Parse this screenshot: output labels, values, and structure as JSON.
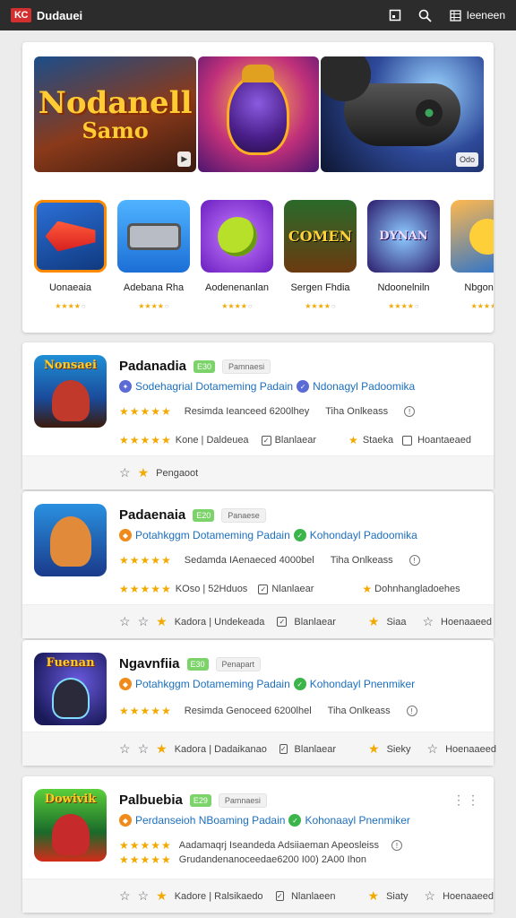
{
  "topbar": {
    "logo": "KC",
    "app_name": "Dudauei",
    "menu_label": "Ieeneen"
  },
  "featured": {
    "banners": [
      {
        "line1": "Nodanell",
        "line2": "Samo",
        "chip": ""
      },
      {
        "line1": "",
        "line2": "",
        "chip": ""
      },
      {
        "line1": "",
        "line2": "",
        "chip": "Odo"
      }
    ],
    "tiles": [
      {
        "name": "Uonaeaia",
        "glyph": ""
      },
      {
        "name": "Adebana Rha",
        "glyph": ""
      },
      {
        "name": "Aodenenanlan",
        "glyph": ""
      },
      {
        "name": "Sergen Fhdia",
        "glyph": "COMEN"
      },
      {
        "name": "Ndoonelniln",
        "glyph": "DYNAN"
      },
      {
        "name": "Nbgonieat",
        "glyph": ""
      }
    ]
  },
  "apps": [
    {
      "title": "Padanadia",
      "age": "E30",
      "category": "Pamnaesi",
      "icon_word": "Nonsaei",
      "developer": "Sodehagrial Dotameming Padain",
      "publisher": "Ndonagyl Padoomika",
      "row1_text": "Resimda Ieanceed 6200lhey",
      "row1_extra": "Tiha Onlkeass",
      "row2_text": "Kone | Daldeuea",
      "row2_check": "Blanlaear",
      "row2_right1": "Staeka",
      "row2_right2": "Hoantaeaed",
      "footer_label": "Pengaoot"
    },
    {
      "title": "Padaenaia",
      "age": "E20",
      "category": "Panaese",
      "icon_word": "",
      "developer": "Potahkggm Dotameming Padain",
      "publisher": "Kohondayl Padoomika",
      "row1_text": "Sedamda IAenaeced 4000bel",
      "row1_extra": "Tiha Onlkeass",
      "row2_text": "KOso | 52Hduos",
      "row2_check": "Nlanlaear",
      "row2_right1": "Dohnhangladoehes",
      "row2_right2": "",
      "footer_label": "Kadora | Undekeada",
      "footer_check": "Blanlaear",
      "footer_r1": "Siaa",
      "footer_r2": "Hoenaaeed"
    },
    {
      "title": "Ngavnfiia",
      "age": "E30",
      "category": "Penapart",
      "icon_word": "Fuenan",
      "developer": "Potahkggm Dotameming Padain",
      "publisher": "Kohondayl Pnenmiker",
      "row1_text": "Resimda Genoceed 6200lhel",
      "row1_extra": "Tiha Onlkeass",
      "footer_label": "Kadora | Dadaikanao",
      "footer_check": "Blanlaear",
      "footer_r1": "Sieky",
      "footer_r2": "Hoenaaeed"
    },
    {
      "title": "Palbuebia",
      "age": "E29",
      "category": "Pamnaesi",
      "icon_word": "Dowivik",
      "developer": "Perdanseioh NBoaming Padain",
      "publisher": "Kohonaayl Pnenmiker",
      "row1_text": "Aadamaqrj Iseandeda Adsiiaeman Apeosleiss",
      "row1b_text": "Grudandenanoceedae6200 I00) 2A00 Ihon",
      "footer_label": "Kadore | Ralsikaedo",
      "footer_check": "Nlanlaeen",
      "footer_r1": "Siaty",
      "footer_r2": "Hoenaaeed"
    }
  ],
  "colors": {
    "accent": "#f2a900",
    "link": "#1c6fbd",
    "topbar": "#2c2c2c"
  }
}
